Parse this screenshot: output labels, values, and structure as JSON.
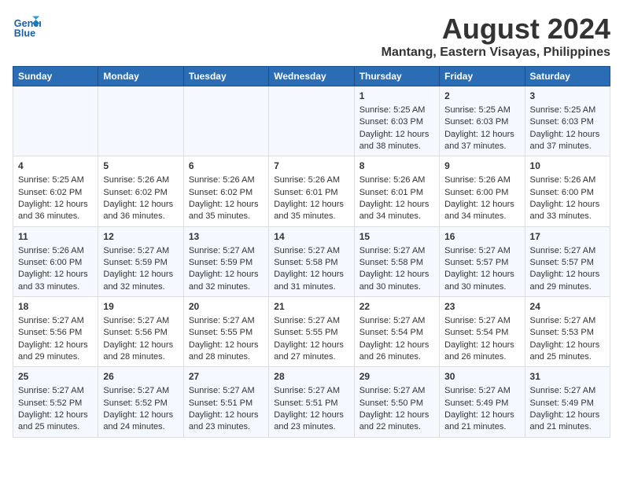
{
  "header": {
    "logo_line1": "General",
    "logo_line2": "Blue",
    "main_title": "August 2024",
    "subtitle": "Mantang, Eastern Visayas, Philippines"
  },
  "days_of_week": [
    "Sunday",
    "Monday",
    "Tuesday",
    "Wednesday",
    "Thursday",
    "Friday",
    "Saturday"
  ],
  "weeks": [
    [
      {
        "day": "",
        "content": ""
      },
      {
        "day": "",
        "content": ""
      },
      {
        "day": "",
        "content": ""
      },
      {
        "day": "",
        "content": ""
      },
      {
        "day": "1",
        "content": "Sunrise: 5:25 AM\nSunset: 6:03 PM\nDaylight: 12 hours\nand 38 minutes."
      },
      {
        "day": "2",
        "content": "Sunrise: 5:25 AM\nSunset: 6:03 PM\nDaylight: 12 hours\nand 37 minutes."
      },
      {
        "day": "3",
        "content": "Sunrise: 5:25 AM\nSunset: 6:03 PM\nDaylight: 12 hours\nand 37 minutes."
      }
    ],
    [
      {
        "day": "4",
        "content": "Sunrise: 5:25 AM\nSunset: 6:02 PM\nDaylight: 12 hours\nand 36 minutes."
      },
      {
        "day": "5",
        "content": "Sunrise: 5:26 AM\nSunset: 6:02 PM\nDaylight: 12 hours\nand 36 minutes."
      },
      {
        "day": "6",
        "content": "Sunrise: 5:26 AM\nSunset: 6:02 PM\nDaylight: 12 hours\nand 35 minutes."
      },
      {
        "day": "7",
        "content": "Sunrise: 5:26 AM\nSunset: 6:01 PM\nDaylight: 12 hours\nand 35 minutes."
      },
      {
        "day": "8",
        "content": "Sunrise: 5:26 AM\nSunset: 6:01 PM\nDaylight: 12 hours\nand 34 minutes."
      },
      {
        "day": "9",
        "content": "Sunrise: 5:26 AM\nSunset: 6:00 PM\nDaylight: 12 hours\nand 34 minutes."
      },
      {
        "day": "10",
        "content": "Sunrise: 5:26 AM\nSunset: 6:00 PM\nDaylight: 12 hours\nand 33 minutes."
      }
    ],
    [
      {
        "day": "11",
        "content": "Sunrise: 5:26 AM\nSunset: 6:00 PM\nDaylight: 12 hours\nand 33 minutes."
      },
      {
        "day": "12",
        "content": "Sunrise: 5:27 AM\nSunset: 5:59 PM\nDaylight: 12 hours\nand 32 minutes."
      },
      {
        "day": "13",
        "content": "Sunrise: 5:27 AM\nSunset: 5:59 PM\nDaylight: 12 hours\nand 32 minutes."
      },
      {
        "day": "14",
        "content": "Sunrise: 5:27 AM\nSunset: 5:58 PM\nDaylight: 12 hours\nand 31 minutes."
      },
      {
        "day": "15",
        "content": "Sunrise: 5:27 AM\nSunset: 5:58 PM\nDaylight: 12 hours\nand 30 minutes."
      },
      {
        "day": "16",
        "content": "Sunrise: 5:27 AM\nSunset: 5:57 PM\nDaylight: 12 hours\nand 30 minutes."
      },
      {
        "day": "17",
        "content": "Sunrise: 5:27 AM\nSunset: 5:57 PM\nDaylight: 12 hours\nand 29 minutes."
      }
    ],
    [
      {
        "day": "18",
        "content": "Sunrise: 5:27 AM\nSunset: 5:56 PM\nDaylight: 12 hours\nand 29 minutes."
      },
      {
        "day": "19",
        "content": "Sunrise: 5:27 AM\nSunset: 5:56 PM\nDaylight: 12 hours\nand 28 minutes."
      },
      {
        "day": "20",
        "content": "Sunrise: 5:27 AM\nSunset: 5:55 PM\nDaylight: 12 hours\nand 28 minutes."
      },
      {
        "day": "21",
        "content": "Sunrise: 5:27 AM\nSunset: 5:55 PM\nDaylight: 12 hours\nand 27 minutes."
      },
      {
        "day": "22",
        "content": "Sunrise: 5:27 AM\nSunset: 5:54 PM\nDaylight: 12 hours\nand 26 minutes."
      },
      {
        "day": "23",
        "content": "Sunrise: 5:27 AM\nSunset: 5:54 PM\nDaylight: 12 hours\nand 26 minutes."
      },
      {
        "day": "24",
        "content": "Sunrise: 5:27 AM\nSunset: 5:53 PM\nDaylight: 12 hours\nand 25 minutes."
      }
    ],
    [
      {
        "day": "25",
        "content": "Sunrise: 5:27 AM\nSunset: 5:52 PM\nDaylight: 12 hours\nand 25 minutes."
      },
      {
        "day": "26",
        "content": "Sunrise: 5:27 AM\nSunset: 5:52 PM\nDaylight: 12 hours\nand 24 minutes."
      },
      {
        "day": "27",
        "content": "Sunrise: 5:27 AM\nSunset: 5:51 PM\nDaylight: 12 hours\nand 23 minutes."
      },
      {
        "day": "28",
        "content": "Sunrise: 5:27 AM\nSunset: 5:51 PM\nDaylight: 12 hours\nand 23 minutes."
      },
      {
        "day": "29",
        "content": "Sunrise: 5:27 AM\nSunset: 5:50 PM\nDaylight: 12 hours\nand 22 minutes."
      },
      {
        "day": "30",
        "content": "Sunrise: 5:27 AM\nSunset: 5:49 PM\nDaylight: 12 hours\nand 21 minutes."
      },
      {
        "day": "31",
        "content": "Sunrise: 5:27 AM\nSunset: 5:49 PM\nDaylight: 12 hours\nand 21 minutes."
      }
    ]
  ]
}
